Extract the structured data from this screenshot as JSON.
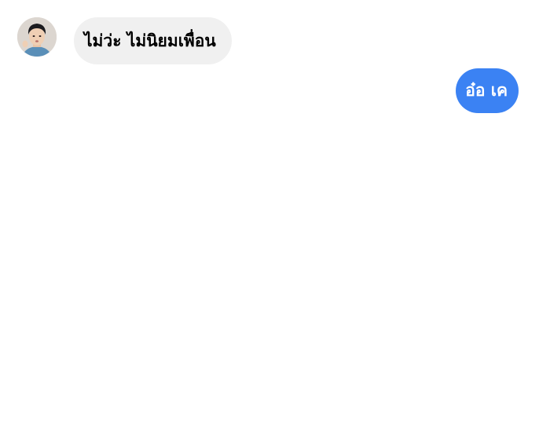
{
  "conversation": {
    "contact": {
      "avatar_icon": "profile-photo-avatar"
    },
    "messages": [
      {
        "direction": "incoming",
        "text": "ไม่ว่ะ ไม่นิยมเพื่อน"
      },
      {
        "direction": "outgoing",
        "text": "อ๋อ เค"
      }
    ]
  },
  "colors": {
    "incoming_bubble": "#f0f0f0",
    "outgoing_bubble": "#3b82f3",
    "incoming_text": "#000000",
    "outgoing_text": "#ffffff",
    "background": "#ffffff"
  }
}
